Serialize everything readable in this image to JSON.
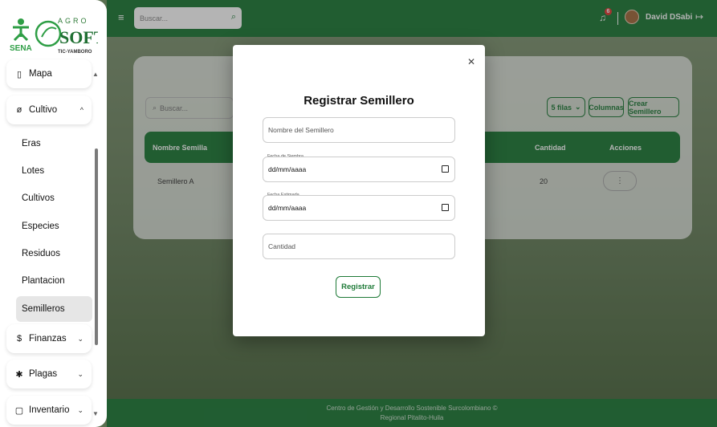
{
  "brand": {
    "name_top": "AGRO",
    "name_bottom": "SOFT",
    "sub": "TIC-YAMBORO",
    "org": "SENA"
  },
  "topbar": {
    "search_placeholder": "Buscar...",
    "notifications": "6",
    "user": "David DSabi"
  },
  "sidebar": {
    "items": [
      {
        "label": "Mapa",
        "icon": "map-icon"
      },
      {
        "label": "Cultivo",
        "icon": "leaf-icon"
      },
      {
        "label": "Finanzas",
        "icon": "dollar-icon"
      },
      {
        "label": "Plagas",
        "icon": "bug-icon"
      },
      {
        "label": "Inventario",
        "icon": "clipboard-icon"
      }
    ],
    "cultivo_sub": [
      "Eras",
      "Lotes",
      "Cultivos",
      "Especies",
      "Residuos",
      "Plantacion",
      "Semilleros"
    ],
    "active_sub": "Semilleros"
  },
  "background": {
    "search_placeholder": "Buscar...",
    "rows_button": "5 filas",
    "columns_button": "Columnas",
    "create_button": "Crear Semillero",
    "headers": [
      "Nombre Semilla",
      "Cantidad",
      "Acciones"
    ],
    "rows": [
      {
        "name": "Semillero A",
        "qty": "20",
        "action": "⋮"
      }
    ]
  },
  "modal": {
    "title": "Registrar Semillero",
    "name_placeholder": "Nombre del Semillero",
    "sow_label": "Fecha de Siembra",
    "sow_value": "dd/mm/aaaa",
    "est_label": "Fecha Estimada",
    "est_value": "dd/mm/aaaa",
    "qty_placeholder": "Cantidad",
    "submit": "Registrar"
  },
  "footer": {
    "line1": "Centro de Gestión y Desarrollo Sostenible Surcolombiano ©",
    "line2": "Regional Pitalito-Huila"
  },
  "colors": {
    "primary": "#1e7a37",
    "badge": "#e53935"
  }
}
